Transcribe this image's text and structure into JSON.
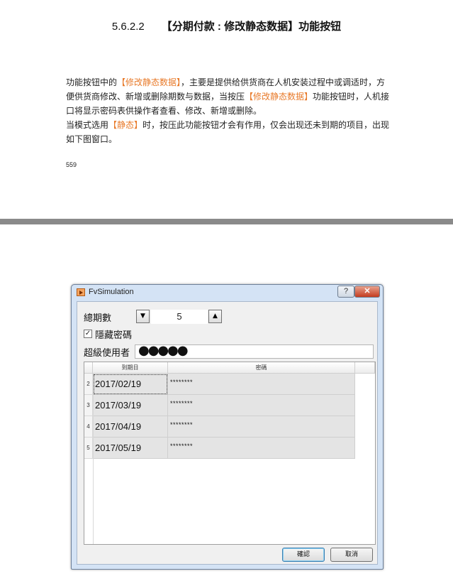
{
  "document": {
    "section_number": "5.6.2.2",
    "section_title": "【分期付款 : 修改静态数据】功能按钮",
    "paragraph": {
      "p1_a": "功能按钮中的",
      "p1_hl1": "【修改静态数据】",
      "p1_b": "，主要是提供给供货商在人机安装过程中或调适时，方便供货商修改、新增或删除期数与数据，当按压",
      "p1_hl2": "【修改静态数据】",
      "p1_c": "功能按钮时，人机接口将显示密码表供操作者查看、修改、新增或删除。",
      "p2_a": "当模式选用",
      "p2_hl": "【静态】",
      "p2_b": "时，按压此功能按钮才会有作用，仅会出现还未到期的项目，出现如下图窗口。"
    },
    "page_number": "559"
  },
  "window": {
    "title": "FvSimulation",
    "help_label": "?",
    "close_label": "✕",
    "total_periods_label": "總期數",
    "spinner_down": "▼",
    "spinner_up": "▲",
    "total_periods_value": "5",
    "hide_password_checked": "✓",
    "hide_password_label": "隱藏密碼",
    "super_user_label": "超級使用者",
    "super_user_password": "●●●●●",
    "table": {
      "headers": [
        "到期日",
        "密碼"
      ],
      "rows": [
        {
          "index": "2",
          "date": "2017/02/19",
          "password": "********"
        },
        {
          "index": "3",
          "date": "2017/03/19",
          "password": "********"
        },
        {
          "index": "4",
          "date": "2017/04/19",
          "password": "********"
        },
        {
          "index": "5",
          "date": "2017/05/19",
          "password": "********"
        }
      ]
    },
    "ok_label": "確認",
    "cancel_label": "取消"
  }
}
